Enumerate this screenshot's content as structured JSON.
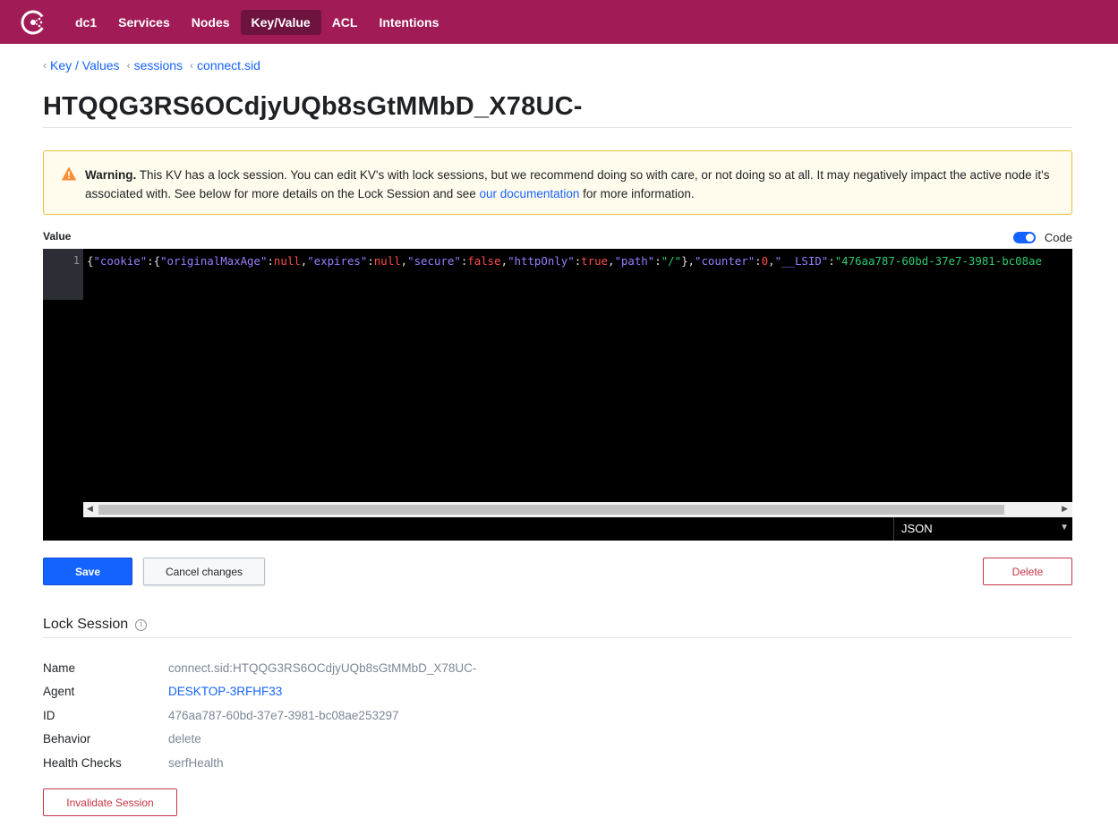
{
  "nav": {
    "items": [
      {
        "label": "dc1",
        "active": false
      },
      {
        "label": "Services",
        "active": false
      },
      {
        "label": "Nodes",
        "active": false
      },
      {
        "label": "Key/Value",
        "active": true
      },
      {
        "label": "ACL",
        "active": false
      },
      {
        "label": "Intentions",
        "active": false
      }
    ]
  },
  "breadcrumb": [
    "Key / Values",
    "sessions",
    "connect.sid"
  ],
  "page_title": "HTQQG3RS6OCdjyUQb8sGtMMbD_X78UC-",
  "warning": {
    "title": "Warning.",
    "body": "This KV has a lock session. You can edit KV's with lock sessions, but we recommend doing so with care, or not doing so at all. It may negatively impact the active node it's associated with. See below for more details on the Lock Session and see",
    "link": "our documentation",
    "tail": "for more information."
  },
  "editor": {
    "label": "Value",
    "code_toggle_label": "Code",
    "code_toggle_on": true,
    "line_number": "1",
    "mode": "JSON",
    "tokens": [
      {
        "t": "p",
        "v": "{"
      },
      {
        "t": "k",
        "v": "\"cookie\""
      },
      {
        "t": "p",
        "v": ":{"
      },
      {
        "t": "k",
        "v": "\"originalMaxAge\""
      },
      {
        "t": "p",
        "v": ":"
      },
      {
        "t": "n",
        "v": "null"
      },
      {
        "t": "p",
        "v": ","
      },
      {
        "t": "k",
        "v": "\"expires\""
      },
      {
        "t": "p",
        "v": ":"
      },
      {
        "t": "n",
        "v": "null"
      },
      {
        "t": "p",
        "v": ","
      },
      {
        "t": "k",
        "v": "\"secure\""
      },
      {
        "t": "p",
        "v": ":"
      },
      {
        "t": "n",
        "v": "false"
      },
      {
        "t": "p",
        "v": ","
      },
      {
        "t": "k",
        "v": "\"httpOnly\""
      },
      {
        "t": "p",
        "v": ":"
      },
      {
        "t": "n",
        "v": "true"
      },
      {
        "t": "p",
        "v": ","
      },
      {
        "t": "k",
        "v": "\"path\""
      },
      {
        "t": "p",
        "v": ":"
      },
      {
        "t": "s",
        "v": "\"/\""
      },
      {
        "t": "p",
        "v": "},"
      },
      {
        "t": "k",
        "v": "\"counter\""
      },
      {
        "t": "p",
        "v": ":"
      },
      {
        "t": "n",
        "v": "0"
      },
      {
        "t": "p",
        "v": ","
      },
      {
        "t": "k",
        "v": "\"__LSID\""
      },
      {
        "t": "p",
        "v": ":"
      },
      {
        "t": "s",
        "v": "\"476aa787-60bd-37e7-3981-bc08ae"
      }
    ]
  },
  "buttons": {
    "save": "Save",
    "cancel": "Cancel changes",
    "delete": "Delete",
    "invalidate": "Invalidate Session"
  },
  "lock_session": {
    "title": "Lock Session",
    "info_icon_glyph": "i",
    "rows": [
      {
        "label": "Name",
        "value": "connect.sid:HTQQG3RS6OCdjyUQb8sGtMMbD_X78UC-",
        "link": false
      },
      {
        "label": "Agent",
        "value": "DESKTOP-3RFHF33",
        "link": true
      },
      {
        "label": "ID",
        "value": "476aa787-60bd-37e7-3981-bc08ae253297",
        "link": false
      },
      {
        "label": "Behavior",
        "value": "delete",
        "link": false
      },
      {
        "label": "Health Checks",
        "value": "serfHealth",
        "link": false
      }
    ]
  },
  "colors": {
    "nav_bg": "#a11c56",
    "nav_active": "#6e1240",
    "primary": "#1563ff",
    "danger": "#c73445",
    "warning_bg": "#fffbed",
    "warning_border": "#e8c13d"
  }
}
